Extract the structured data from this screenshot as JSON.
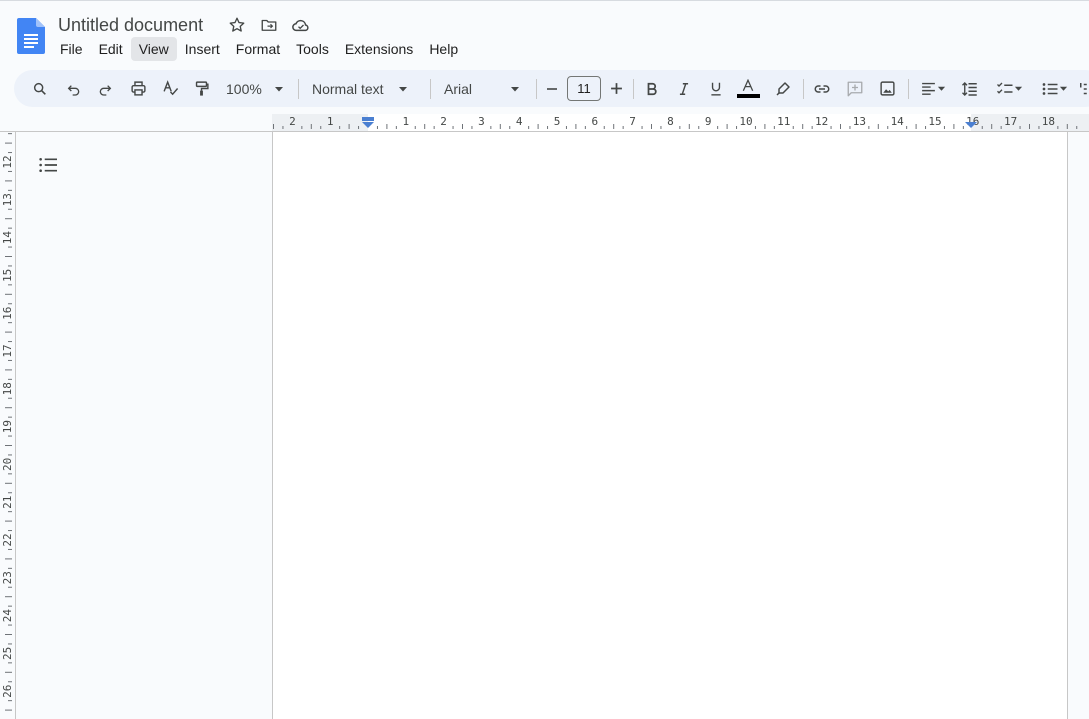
{
  "document": {
    "title": "Untitled document"
  },
  "menu": [
    "File",
    "Edit",
    "View",
    "Insert",
    "Format",
    "Tools",
    "Extensions",
    "Help"
  ],
  "menu_active": "View",
  "toolbar": {
    "zoom": "100%",
    "style": "Normal text",
    "font": "Arial",
    "font_size": "11"
  },
  "ruler": {
    "horizontal_labels": [
      "2",
      "1",
      "1",
      "2",
      "3",
      "4",
      "5",
      "6",
      "7",
      "8",
      "9",
      "10",
      "11",
      "12",
      "13",
      "14",
      "15",
      "16",
      "17",
      "18"
    ],
    "vertical_labels": [
      "12",
      "13",
      "14",
      "15",
      "16",
      "17",
      "18",
      "19",
      "20",
      "21",
      "22",
      "23",
      "24",
      "25",
      "26"
    ]
  },
  "colors": {
    "brand": "#4285f4",
    "text_color_bar": "#000000"
  }
}
